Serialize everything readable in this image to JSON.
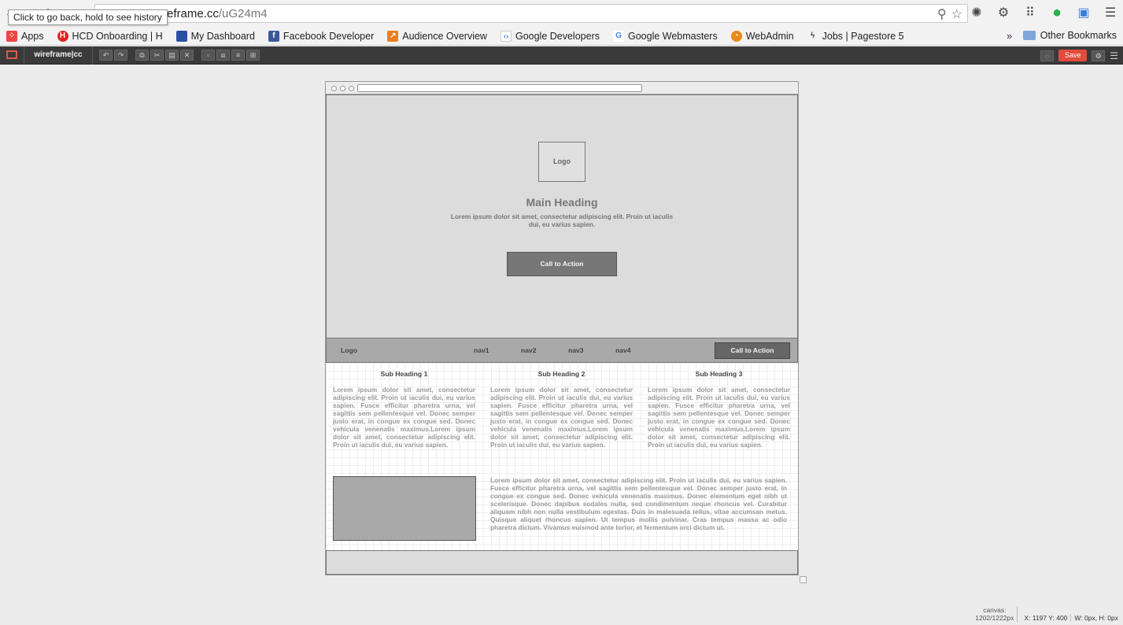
{
  "browser": {
    "tooltip": "Click to go back, hold to see history",
    "url_host_fragment": "reframe.cc",
    "url_path": "/uG24m4",
    "bookmarks": [
      {
        "label": "Apps",
        "icon": "apps-grid-icon",
        "color": "#e44"
      },
      {
        "label": "HCD Onboarding | H",
        "icon": "hcd-icon",
        "color": "#d22"
      },
      {
        "label": "My Dashboard",
        "icon": "dashboard-icon",
        "color": "#2a4fa3"
      },
      {
        "label": "Facebook Developer",
        "icon": "facebook-icon",
        "color": "#3b5998"
      },
      {
        "label": "Audience Overview",
        "icon": "analytics-icon",
        "color": "#f07c1a"
      },
      {
        "label": "Google Developers",
        "icon": "google-developers-icon",
        "color": "#4285f4"
      },
      {
        "label": "Google Webmasters",
        "icon": "google-icon",
        "color": "#4285f4"
      },
      {
        "label": "WebAdmin",
        "icon": "webadmin-icon",
        "color": "#e88a1a"
      },
      {
        "label": "Jobs | Pagestore 5",
        "icon": "lightning-icon",
        "color": "#444"
      }
    ],
    "overflow": "»",
    "other_bookmarks": "Other Bookmarks"
  },
  "app": {
    "brand": "wireframe|cc",
    "save_label": "Save",
    "accent": "#e34b3c"
  },
  "wireframe": {
    "hero": {
      "logo": "Logo",
      "heading": "Main Heading",
      "lead": "Lorem ipsum dolor sit amet, consectetur adipiscing elit. Proin ut iaculis dui, eu varius sapien.",
      "cta": "Call to Action"
    },
    "nav": {
      "logo": "Logo",
      "items": [
        "nav1",
        "nav2",
        "nav3",
        "nav4"
      ],
      "cta": "Call to Action"
    },
    "columns": [
      {
        "heading": "Sub Heading 1",
        "text": "Lorem ipsum dolor sit amet, consectetur adipiscing elit. Proin ut iaculis dui, eu varius sapien. Fusce efficitur pharetra urna, vel sagittis sem pellentesque vel. Donec semper justo erat, in congue ex congue sed. Donec vehicula venenatis maximus.Lorem ipsum dolor sit amet, consectetur adipiscing elit. Proin ut iaculis dui, eu varius sapien."
      },
      {
        "heading": "Sub Heading 2",
        "text": "Lorem ipsum dolor sit amet, consectetur adipiscing elit. Proin ut iaculis dui, eu varius sapien. Fusce efficitur pharetra urna, vel sagittis sem pellentesque vel. Donec semper justo erat, in congue ex congue sed. Donec vehicula venenatis maximus.Lorem ipsum dolor sit amet, consectetur adipiscing elit. Proin ut iaculis dui, eu varius sapien."
      },
      {
        "heading": "Sub Heading 3",
        "text": "Lorem ipsum dolor sit amet, consectetur adipiscing elit. Proin ut iaculis dui, eu varius sapien. Fusce efficitur pharetra urna, vel sagittis sem pellentesque vel. Donec semper justo erat, in congue ex congue sed. Donec vehicula venenatis maximus.Lorem ipsum dolor sit amet, consectetur adipiscing elit. Proin ut iaculis dui, eu varius sapien."
      }
    ],
    "long_text": "Lorem ipsum dolor sit amet, consectetur adipiscing elit. Proin ut iaculis dui, eu varius sapien. Fusce efficitur pharetra urna, vel sagittis sem pellentesque vel. Donec semper justo erat, in congue ex congue sed. Donec vehicula venenatis maximus. Donec elementum eget nibh ut scelerisque. Donec dapibus sodales nulla, sed condimentum neque rhoncus vel. Curabitur aliquam nibh non nulla vestibulum egestas. Duis in malesuada tellus, vitae accumsan metus. Quisque aliquet rhoncus sapien. Ut tempus mollis pulvinar. Cras tempus massa ac odio pharetra dictum. Vivamus euismod ante tortor, et fermentum orci dictum ut."
  },
  "status": {
    "canvas_label": "canvas:",
    "canvas_size": "1202/1222px",
    "coords": "X: 1197 Y: 400",
    "dims": "W: 0px, H: 0px"
  }
}
